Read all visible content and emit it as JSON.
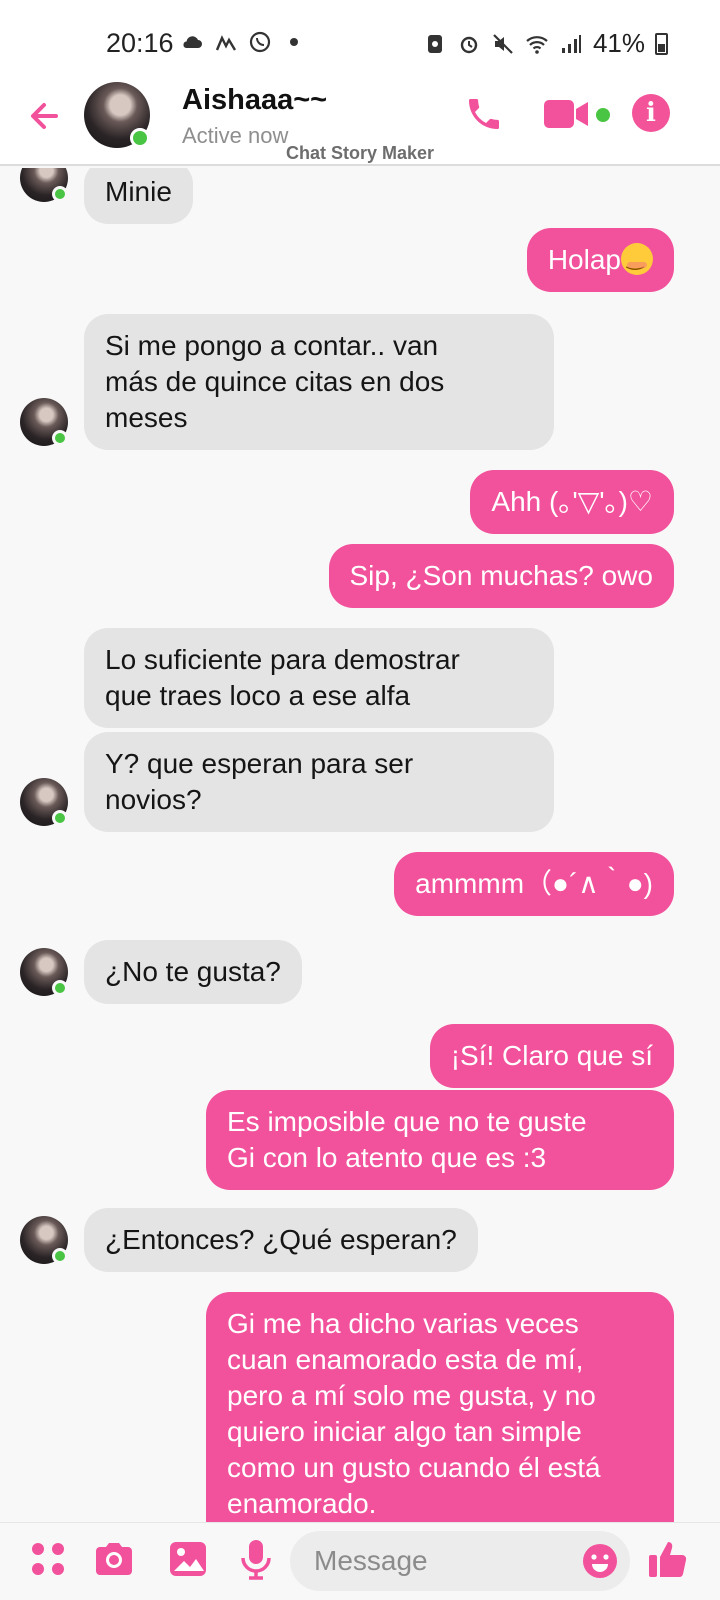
{
  "status_bar": {
    "time": "20:16",
    "battery": "41%"
  },
  "header": {
    "name": "Aishaaa~~",
    "status": "Active now",
    "watermark": "Chat Story Maker"
  },
  "messages": [
    {
      "side": "in",
      "text": "Minie"
    },
    {
      "side": "out",
      "text": "Holap"
    },
    {
      "side": "in",
      "line1": "Si me pongo a contar.. van",
      "line2": "más de quince citas en dos",
      "line3": "meses"
    },
    {
      "side": "out",
      "text": "Ahh (｡'▽'｡)♡"
    },
    {
      "side": "out",
      "text": "Sip, ¿Son muchas? owo"
    },
    {
      "side": "in",
      "line1": "Lo suficiente para demostrar",
      "line2": "que traes loco a ese alfa"
    },
    {
      "side": "in",
      "line1": "Y? que esperan para ser",
      "line2": "novios?"
    },
    {
      "side": "out",
      "text": "ammmm（●´∧｀●)"
    },
    {
      "side": "in",
      "text": "¿No te gusta?"
    },
    {
      "side": "out",
      "text": "¡Sí! Claro que sí"
    },
    {
      "side": "out",
      "line1": "Es imposible que no te guste",
      "line2": "Gi con lo atento que es :3"
    },
    {
      "side": "in",
      "text": "¿Entonces? ¿Qué esperan?"
    },
    {
      "side": "out",
      "line1": "Gi me ha dicho varias veces",
      "line2": "cuan enamorado esta de mí,",
      "line3": "pero a mí solo me gusta, y no",
      "line4": "quiero iniciar algo tan simple",
      "line5": "como un gusto cuando él está",
      "line6": "enamorado."
    }
  ],
  "composer": {
    "placeholder": "Message"
  },
  "colors": {
    "accent": "#f2519c",
    "online": "#49c443",
    "incoming_bubble": "#e4e4e4"
  },
  "icons": [
    "back-arrow-icon",
    "phone-icon",
    "video-icon",
    "info-icon",
    "apps-icon",
    "camera-icon",
    "gallery-icon",
    "mic-icon",
    "emoji-icon",
    "thumbs-up-icon"
  ]
}
